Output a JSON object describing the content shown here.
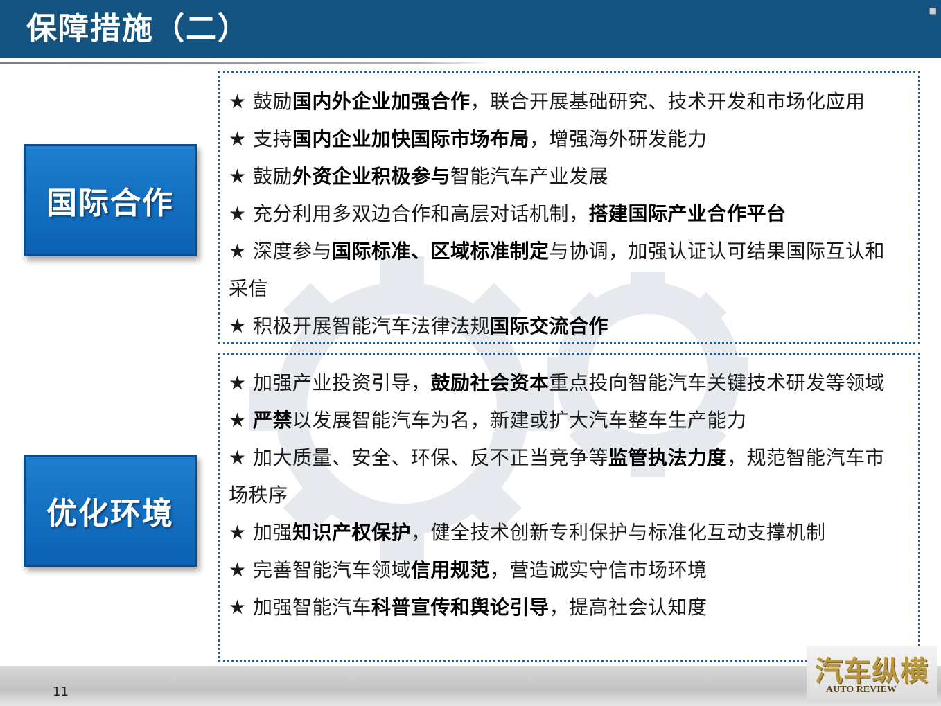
{
  "title": "保障措施（二）",
  "side_buttons": [
    "国际合作",
    "优化环境"
  ],
  "panels": [
    {
      "items": [
        [
          {
            "t": "★ 鼓励"
          },
          {
            "t": "国内外企业加强合作",
            "b": true
          },
          {
            "t": "，联合开展基础研究、技术开发和市场化应用"
          }
        ],
        [
          {
            "t": "★ 支持"
          },
          {
            "t": "国内企业加快国际市场布局",
            "b": true
          },
          {
            "t": "，增强海外研发能力"
          }
        ],
        [
          {
            "t": "★ 鼓励"
          },
          {
            "t": "外资企业积极参与",
            "b": true
          },
          {
            "t": "智能汽车产业发展"
          }
        ],
        [
          {
            "t": "★ 充分利用多双边合作和高层对话机制，"
          },
          {
            "t": "搭建国际产业合作平台",
            "b": true
          }
        ],
        [
          {
            "t": "★ 深度参与"
          },
          {
            "t": "国际标准、区域标准制定",
            "b": true
          },
          {
            "t": "与协调，加强认证认可结果国际互认和采信"
          }
        ],
        [
          {
            "t": "★ 积极开展智能汽车法律法规"
          },
          {
            "t": "国际交流合作",
            "b": true
          }
        ]
      ]
    },
    {
      "items": [
        [
          {
            "t": "★ 加强产业投资引导，"
          },
          {
            "t": "鼓励社会资本",
            "b": true
          },
          {
            "t": "重点投向智能汽车关键技术研发等领域"
          }
        ],
        [
          {
            "t": "★ "
          },
          {
            "t": "严禁",
            "b": true
          },
          {
            "t": "以发展智能汽车为名，新建或扩大汽车整车生产能力"
          }
        ],
        [
          {
            "t": "★ 加大质量、安全、环保、反不正当竞争等"
          },
          {
            "t": "监管执法力度",
            "b": true
          },
          {
            "t": "，规范智能汽车市场秩序"
          }
        ],
        [
          {
            "t": "★ 加强"
          },
          {
            "t": "知识产权保护",
            "b": true
          },
          {
            "t": "，健全技术创新专利保护与标准化互动支撑机制"
          }
        ],
        [
          {
            "t": "★ 完善智能汽车领域"
          },
          {
            "t": "信用规范",
            "b": true
          },
          {
            "t": "，营造诚实守信市场环境"
          }
        ],
        [
          {
            "t": "★ 加强智能汽车"
          },
          {
            "t": "科普宣传和舆论引导",
            "b": true
          },
          {
            "t": "，提高社会认知度"
          }
        ]
      ]
    }
  ],
  "page_number": "11",
  "logo": {
    "main": "汽车纵横",
    "sub": "AUTO REVIEW"
  },
  "colors": {
    "header": "#14527f",
    "button": "#1470c4",
    "panel_border": "#1a5da8"
  }
}
